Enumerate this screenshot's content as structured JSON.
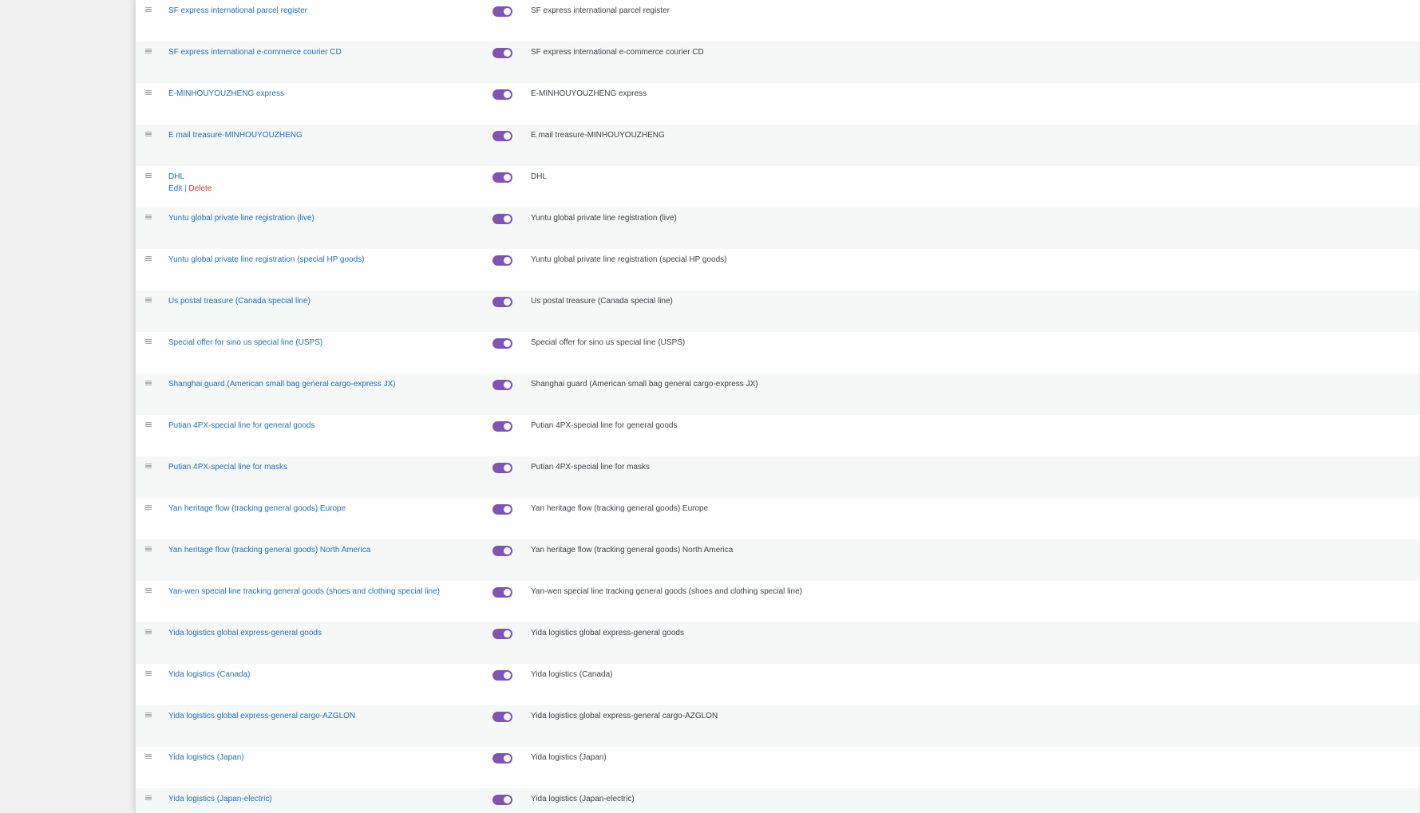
{
  "rows": [
    {
      "name": "SF express international parcel register",
      "description": "SF express international parcel register"
    },
    {
      "name": "SF express international e-commerce courier CD",
      "description": "SF express international e-commerce courier CD"
    },
    {
      "name": "E-MINHOUYOUZHENG express",
      "description": "E-MINHOUYOUZHENG express"
    },
    {
      "name": "E mail treasure-MINHOUYOUZHENG",
      "description": "E mail treasure-MINHOUYOUZHENG"
    },
    {
      "name": "DHL",
      "description": "DHL",
      "actions": {
        "edit": "Edit",
        "separator": "|",
        "delete": "Delete"
      }
    },
    {
      "name": "Yuntu global private line registration (live)",
      "description": "Yuntu global private line registration (live)"
    },
    {
      "name": "Yuntu global private line registration (special HP goods)",
      "description": "Yuntu global private line registration (special HP goods)"
    },
    {
      "name": "Us postal treasure (Canada special line)",
      "description": "Us postal treasure (Canada special line)"
    },
    {
      "name": "Special offer for sino us special line (USPS)",
      "description": "Special offer for sino us special line (USPS)"
    },
    {
      "name": "Shanghai guard (American small bag general cargo-express JX)",
      "description": "Shanghai guard (American small bag general cargo-express JX)"
    },
    {
      "name": "Putian 4PX-special line for general goods",
      "description": "Putian 4PX-special line for general goods"
    },
    {
      "name": "Putian 4PX-special line for masks",
      "description": "Putian 4PX-special line for masks"
    },
    {
      "name": "Yan heritage flow (tracking general goods) Europe",
      "description": "Yan heritage flow (tracking general goods) Europe"
    },
    {
      "name": "Yan heritage flow (tracking general goods) North America",
      "description": "Yan heritage flow (tracking general goods) North America"
    },
    {
      "name": "Yan-wen special line tracking general goods (shoes and clothing special line)",
      "description": "Yan-wen special line tracking general goods (shoes and clothing special line)"
    },
    {
      "name": "Yida logistics global express-general goods",
      "description": "Yida logistics global express-general goods"
    },
    {
      "name": "Yida logistics (Canada)",
      "description": "Yida logistics (Canada)"
    },
    {
      "name": "Yida logistics global express-general cargo-AZGLON",
      "description": "Yida logistics global express-general cargo-AZGLON"
    },
    {
      "name": "Yida logistics (Japan)",
      "description": "Yida logistics (Japan)"
    },
    {
      "name": "Yida logistics (Japan-electric)",
      "description": "Yida logistics (Japan-electric)"
    }
  ],
  "toggle_state": "enabled",
  "colors": {
    "toggle_on": "#7f54b3",
    "link": "#2271b1",
    "delete": "#d63638",
    "row_alt": "#f6f7f7"
  },
  "icons": {
    "drag_handle": "drag-handle-icon"
  }
}
